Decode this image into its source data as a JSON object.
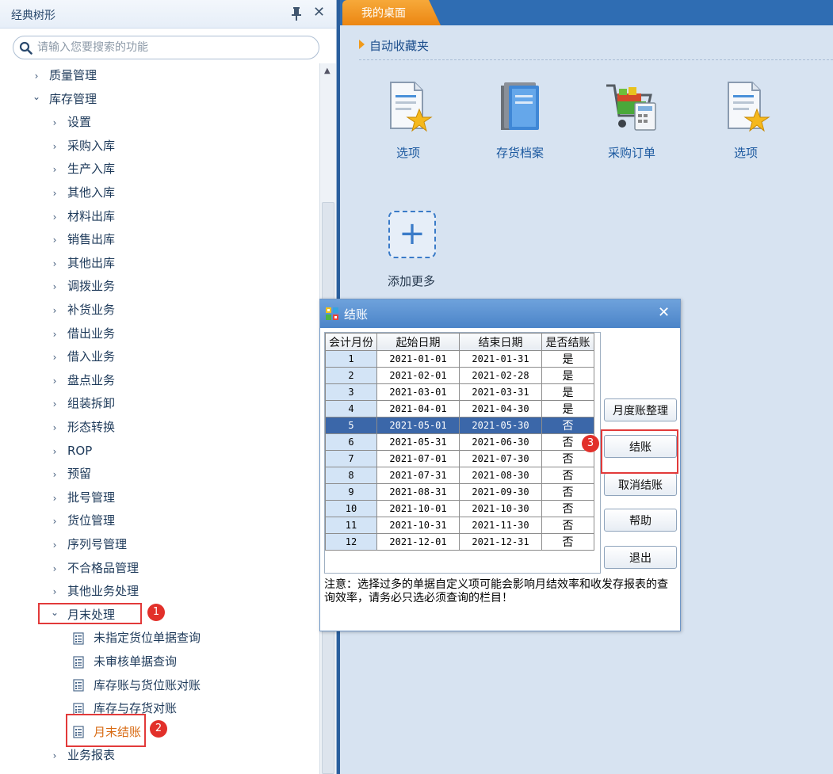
{
  "left_panel": {
    "title": "经典树形",
    "search_placeholder": "请输入您要搜索的功能"
  },
  "tree": {
    "items": [
      {
        "label": "质量管理",
        "state": "collapsed",
        "level": 0
      },
      {
        "label": "库存管理",
        "state": "expanded",
        "level": 0
      },
      {
        "label": "设置",
        "state": "collapsed",
        "level": 1
      },
      {
        "label": "采购入库",
        "state": "collapsed",
        "level": 1
      },
      {
        "label": "生产入库",
        "state": "collapsed",
        "level": 1
      },
      {
        "label": "其他入库",
        "state": "collapsed",
        "level": 1
      },
      {
        "label": "材料出库",
        "state": "collapsed",
        "level": 1
      },
      {
        "label": "销售出库",
        "state": "collapsed",
        "level": 1
      },
      {
        "label": "其他出库",
        "state": "collapsed",
        "level": 1
      },
      {
        "label": "调拨业务",
        "state": "collapsed",
        "level": 1
      },
      {
        "label": "补货业务",
        "state": "collapsed",
        "level": 1
      },
      {
        "label": "借出业务",
        "state": "collapsed",
        "level": 1
      },
      {
        "label": "借入业务",
        "state": "collapsed",
        "level": 1
      },
      {
        "label": "盘点业务",
        "state": "collapsed",
        "level": 1
      },
      {
        "label": "组装拆卸",
        "state": "collapsed",
        "level": 1
      },
      {
        "label": "形态转换",
        "state": "collapsed",
        "level": 1
      },
      {
        "label": "ROP",
        "state": "collapsed",
        "level": 1
      },
      {
        "label": "预留",
        "state": "collapsed",
        "level": 1
      },
      {
        "label": "批号管理",
        "state": "collapsed",
        "level": 1
      },
      {
        "label": "货位管理",
        "state": "collapsed",
        "level": 1
      },
      {
        "label": "序列号管理",
        "state": "collapsed",
        "level": 1
      },
      {
        "label": "不合格品管理",
        "state": "collapsed",
        "level": 1
      },
      {
        "label": "其他业务处理",
        "state": "collapsed",
        "level": 1
      },
      {
        "label": "月末处理",
        "state": "expanded",
        "level": 1
      },
      {
        "label": "未指定货位单据查询",
        "state": "leaf",
        "level": 2
      },
      {
        "label": "未审核单据查询",
        "state": "leaf",
        "level": 2
      },
      {
        "label": "库存账与货位账对账",
        "state": "leaf",
        "level": 2
      },
      {
        "label": "库存与存货对账",
        "state": "leaf",
        "level": 2
      },
      {
        "label": "月末结账",
        "state": "leaf",
        "level": 2,
        "active": true
      },
      {
        "label": "业务报表",
        "state": "collapsed",
        "level": 1
      }
    ]
  },
  "annotations": [
    "1",
    "2",
    "3"
  ],
  "desktop": {
    "tab_label": "我的桌面",
    "favorites_heading": "自动收藏夹",
    "apps": [
      {
        "label": "选项",
        "icon": "options-doc-star-icon"
      },
      {
        "label": "存货档案",
        "icon": "inventory-books-icon"
      },
      {
        "label": "采购订单",
        "icon": "purchase-cart-icon"
      },
      {
        "label": "选项",
        "icon": "options-doc-star-icon"
      }
    ],
    "add_more_label": "添加更多"
  },
  "dialog": {
    "title": "结账",
    "columns": [
      "会计月份",
      "起始日期",
      "结束日期",
      "是否结账"
    ],
    "rows": [
      {
        "month": "1",
        "start": "2021-01-01",
        "end": "2021-01-31",
        "closed": "是"
      },
      {
        "month": "2",
        "start": "2021-02-01",
        "end": "2021-02-28",
        "closed": "是"
      },
      {
        "month": "3",
        "start": "2021-03-01",
        "end": "2021-03-31",
        "closed": "是"
      },
      {
        "month": "4",
        "start": "2021-04-01",
        "end": "2021-04-30",
        "closed": "是"
      },
      {
        "month": "5",
        "start": "2021-05-01",
        "end": "2021-05-30",
        "closed": "否",
        "selected": true
      },
      {
        "month": "6",
        "start": "2021-05-31",
        "end": "2021-06-30",
        "closed": "否"
      },
      {
        "month": "7",
        "start": "2021-07-01",
        "end": "2021-07-30",
        "closed": "否"
      },
      {
        "month": "8",
        "start": "2021-07-31",
        "end": "2021-08-30",
        "closed": "否"
      },
      {
        "month": "9",
        "start": "2021-08-31",
        "end": "2021-09-30",
        "closed": "否"
      },
      {
        "month": "10",
        "start": "2021-10-01",
        "end": "2021-10-30",
        "closed": "否"
      },
      {
        "month": "11",
        "start": "2021-10-31",
        "end": "2021-11-30",
        "closed": "否"
      },
      {
        "month": "12",
        "start": "2021-12-01",
        "end": "2021-12-31",
        "closed": "否"
      }
    ],
    "buttons": {
      "monthly_tidy": "月度账整理",
      "close_account": "结账",
      "cancel_close": "取消结账",
      "help": "帮助",
      "exit": "退出"
    },
    "note": "注意：选择过多的单据自定义项可能会影响月结效率和收发存报表的查询效率，请务必只选必须查询的栏目！"
  },
  "colors": {
    "tab_orange": "#ec8612",
    "titlebar_blue": "#4b84c8",
    "selection_blue": "#3b67a9",
    "annotation_red": "#e2302a"
  }
}
